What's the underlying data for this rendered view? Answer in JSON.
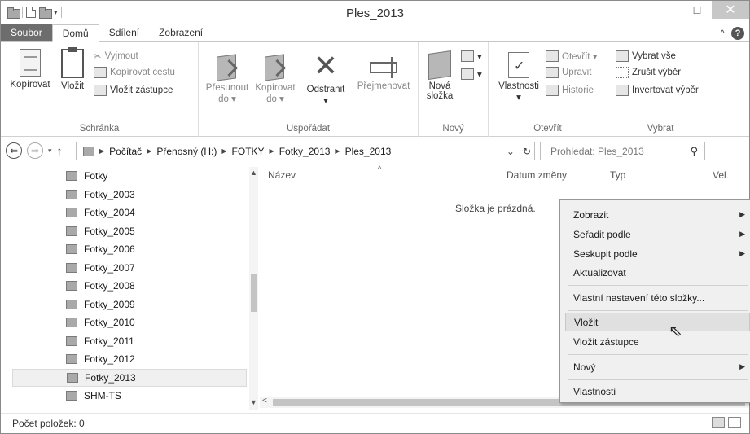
{
  "window": {
    "title": "Ples_2013",
    "minimize": "–",
    "maximize": "□",
    "close": "✕"
  },
  "ribbon_tabs": [
    "Soubor",
    "Domů",
    "Sdílení",
    "Zobrazení"
  ],
  "ribbon": {
    "clipboard": {
      "label": "Schránka",
      "copy": "Kopírovat",
      "paste": "Vložit",
      "cut": "Vyjmout",
      "copy_path": "Kopírovat cestu",
      "paste_shortcut": "Vložit zástupce"
    },
    "organize": {
      "label": "Uspořádat",
      "move_to": "Přesunout do ▾",
      "copy_to": "Kopírovat do ▾",
      "delete": "Odstranit",
      "delete_dd": "▾",
      "rename": "Přejmenovat"
    },
    "new": {
      "label": "Nový",
      "new_folder": "Nová složka"
    },
    "open": {
      "label": "Otevřít",
      "properties": "Vlastnosti",
      "properties_dd": "▾",
      "open": "Otevřít ▾",
      "edit": "Upravit",
      "history": "Historie"
    },
    "select": {
      "label": "Vybrat",
      "select_all": "Vybrat vše",
      "select_none": "Zrušit výběr",
      "invert": "Invertovat výběr"
    }
  },
  "address": {
    "crumbs": [
      "Počítač",
      "Přenosný (H:)",
      "FOTKY",
      "Fotky_2013",
      "Ples_2013"
    ],
    "dropdown": "⌄",
    "refresh": "↻"
  },
  "search": {
    "placeholder": "Prohledat: Ples_2013"
  },
  "nav_items": [
    "Fotky",
    "Fotky_2003",
    "Fotky_2004",
    "Fotky_2005",
    "Fotky_2006",
    "Fotky_2007",
    "Fotky_2008",
    "Fotky_2009",
    "Fotky_2010",
    "Fotky_2011",
    "Fotky_2012",
    "Fotky_2013",
    "SHM-TS"
  ],
  "columns": {
    "name": "Název",
    "date": "Datum změny",
    "type": "Typ",
    "size": "Vel"
  },
  "empty_text": "Složka je prázdná.",
  "status": {
    "items": "Počet položek: 0"
  },
  "context_menu": {
    "view": "Zobrazit",
    "sort_by": "Seřadit podle",
    "group_by": "Seskupit podle",
    "refresh": "Aktualizovat",
    "customize": "Vlastní nastavení této složky...",
    "paste": "Vložit",
    "paste_shortcut": "Vložit zástupce",
    "new": "Nový",
    "properties": "Vlastnosti"
  }
}
